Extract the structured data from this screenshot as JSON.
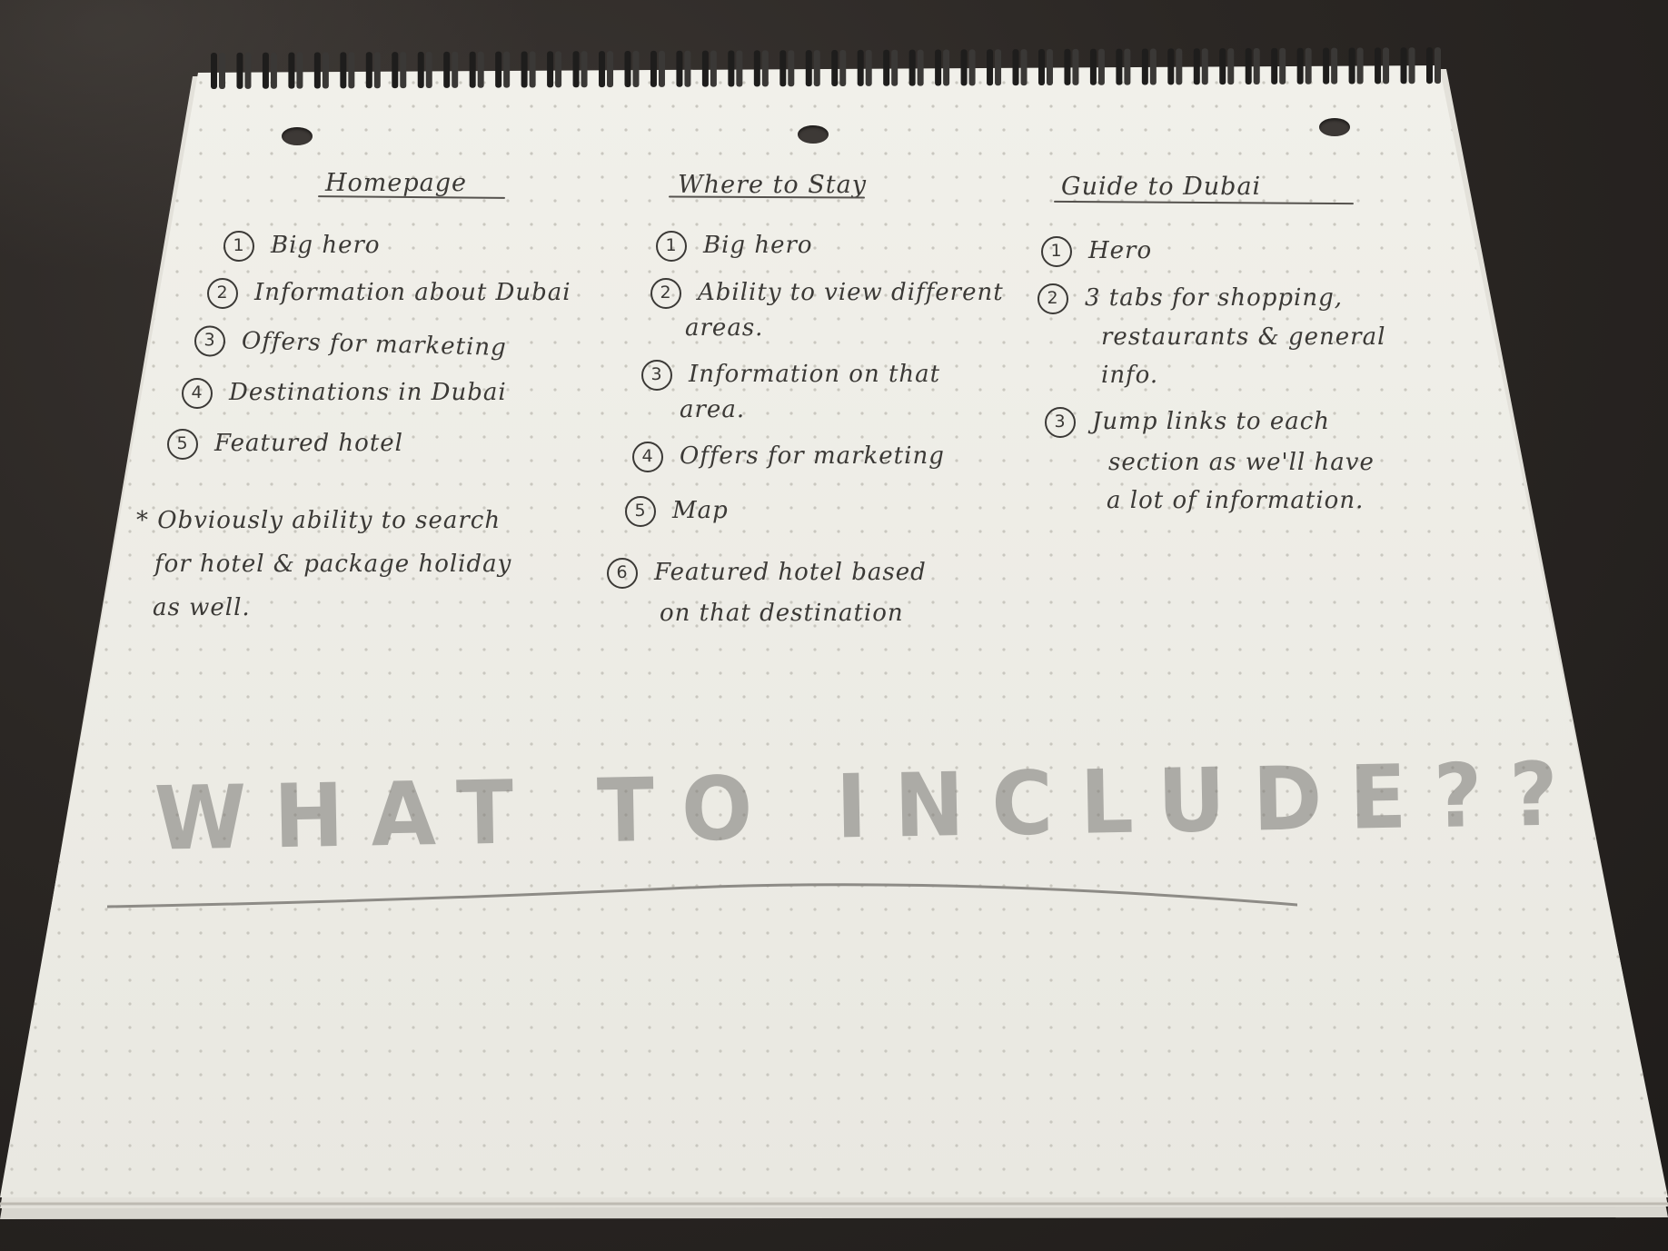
{
  "notebook": {
    "paper_color": "#eeede6",
    "dot_color": "#c9c7bf",
    "ink_color": "#3b3936",
    "pencil_color": "#8a8884"
  },
  "columns": [
    {
      "heading": "Homepage",
      "items": [
        {
          "num": "1",
          "text": "Big hero"
        },
        {
          "num": "2",
          "text": "Information about Dubai"
        },
        {
          "num": "3",
          "text": "Offers for marketing"
        },
        {
          "num": "4",
          "text": "Destinations in Dubai"
        },
        {
          "num": "5",
          "text": "Featured hotel"
        }
      ],
      "note": {
        "lines": [
          "* Obviously ability to search",
          "for hotel & package holiday",
          "as well."
        ]
      }
    },
    {
      "heading": "Where to Stay",
      "items": [
        {
          "num": "1",
          "text": "Big hero"
        },
        {
          "num": "2",
          "text": "Ability to view different",
          "cont": "areas."
        },
        {
          "num": "3",
          "text": "Information on that",
          "cont": "area."
        },
        {
          "num": "4",
          "text": "Offers for marketing"
        },
        {
          "num": "5",
          "text": "Map"
        },
        {
          "num": "6",
          "text": "Featured hotel based",
          "cont": "on that destination"
        }
      ]
    },
    {
      "heading": "Guide to Dubai",
      "items": [
        {
          "num": "1",
          "text": "Hero"
        },
        {
          "num": "2",
          "text": "3 tabs for shopping,",
          "cont": "restaurants & general",
          "cont2": "info."
        },
        {
          "num": "3",
          "text": "Jump links to each",
          "cont": "section as we'll have",
          "cont2": "a lot of information."
        }
      ]
    }
  ],
  "title": "WHAT TO INCLUDE??"
}
